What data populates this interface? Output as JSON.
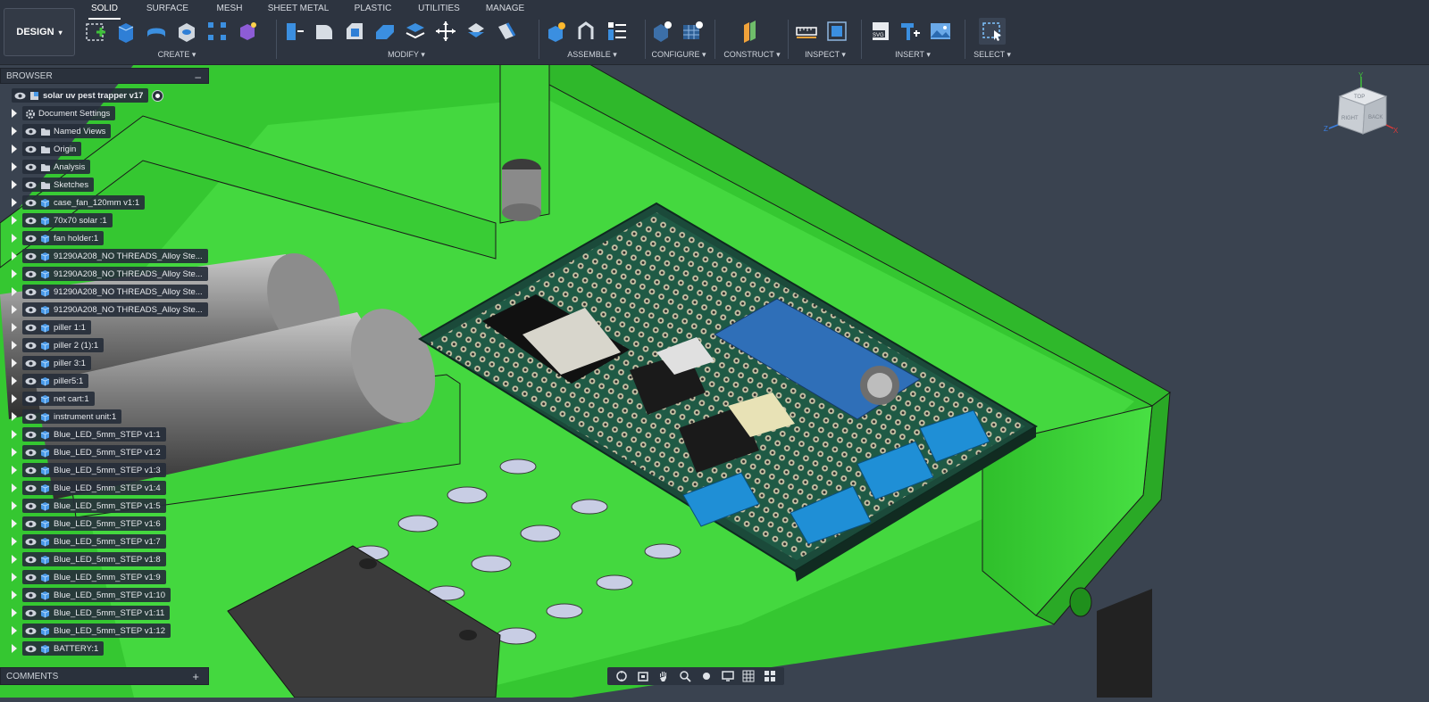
{
  "toolbar": {
    "workspace": "DESIGN",
    "tabs": [
      {
        "label": "SOLID",
        "active": true
      },
      {
        "label": "SURFACE",
        "active": false
      },
      {
        "label": "MESH",
        "active": false
      },
      {
        "label": "SHEET METAL",
        "active": false
      },
      {
        "label": "PLASTIC",
        "active": false
      },
      {
        "label": "UTILITIES",
        "active": false
      },
      {
        "label": "MANAGE",
        "active": false
      }
    ],
    "groups": {
      "create": "CREATE ▾",
      "modify": "MODIFY ▾",
      "assemble": "ASSEMBLE ▾",
      "configure": "CONFIGURE ▾",
      "construct": "CONSTRUCT ▾",
      "inspect": "INSPECT ▾",
      "insert": "INSERT ▾",
      "select": "SELECT ▾"
    },
    "accent": "#0696d7"
  },
  "browser": {
    "title": "BROWSER",
    "collapse": "–",
    "root": "solar uv pest trapper v17",
    "items": [
      {
        "label": "Document Settings",
        "icon": "gear-icon"
      },
      {
        "label": "Named Views",
        "icon": "folder-icon"
      },
      {
        "label": "Origin",
        "icon": "folder-icon"
      },
      {
        "label": "Analysis",
        "icon": "folder-icon"
      },
      {
        "label": "Sketches",
        "icon": "folder-icon"
      },
      {
        "label": "case_fan_120mm v1:1",
        "icon": "component-icon"
      },
      {
        "label": "70x70 solar :1",
        "icon": "component-icon"
      },
      {
        "label": "fan holder:1",
        "icon": "component-icon"
      },
      {
        "label": "91290A208_NO THREADS_Alloy Ste...",
        "icon": "component-icon"
      },
      {
        "label": "91290A208_NO THREADS_Alloy Ste...",
        "icon": "component-icon"
      },
      {
        "label": "91290A208_NO THREADS_Alloy Ste...",
        "icon": "component-icon"
      },
      {
        "label": "91290A208_NO THREADS_Alloy Ste...",
        "icon": "component-icon"
      },
      {
        "label": "piller 1:1",
        "icon": "component-icon"
      },
      {
        "label": "piller 2 (1):1",
        "icon": "component-icon"
      },
      {
        "label": "piller 3:1",
        "icon": "component-icon"
      },
      {
        "label": "piller5:1",
        "icon": "component-icon"
      },
      {
        "label": "net cart:1",
        "icon": "component-icon"
      },
      {
        "label": "instrument unit:1",
        "icon": "component-icon"
      },
      {
        "label": "Blue_LED_5mm_STEP v1:1",
        "icon": "component-icon"
      },
      {
        "label": "Blue_LED_5mm_STEP v1:2",
        "icon": "component-icon"
      },
      {
        "label": "Blue_LED_5mm_STEP v1:3",
        "icon": "component-icon"
      },
      {
        "label": "Blue_LED_5mm_STEP v1:4",
        "icon": "component-icon"
      },
      {
        "label": "Blue_LED_5mm_STEP v1:5",
        "icon": "component-icon"
      },
      {
        "label": "Blue_LED_5mm_STEP v1:6",
        "icon": "component-icon"
      },
      {
        "label": "Blue_LED_5mm_STEP v1:7",
        "icon": "component-icon"
      },
      {
        "label": "Blue_LED_5mm_STEP v1:8",
        "icon": "component-icon"
      },
      {
        "label": "Blue_LED_5mm_STEP v1:9",
        "icon": "component-icon"
      },
      {
        "label": "Blue_LED_5mm_STEP v1:10",
        "icon": "component-icon"
      },
      {
        "label": "Blue_LED_5mm_STEP v1:11",
        "icon": "component-icon"
      },
      {
        "label": "Blue_LED_5mm_STEP v1:12",
        "icon": "component-icon"
      },
      {
        "label": "BATTERY:1",
        "icon": "component-icon"
      }
    ]
  },
  "comments": {
    "title": "COMMENTS",
    "add": "+"
  },
  "viewcube": {
    "top": "Y",
    "left": "Z",
    "right": "X",
    "face_top": "TOP",
    "face_right": "BACK",
    "face_left": "RIGHT"
  },
  "colors": {
    "case_green": "#3fd63a",
    "pcb": "#1e4d3e",
    "background": "#3a4350"
  }
}
